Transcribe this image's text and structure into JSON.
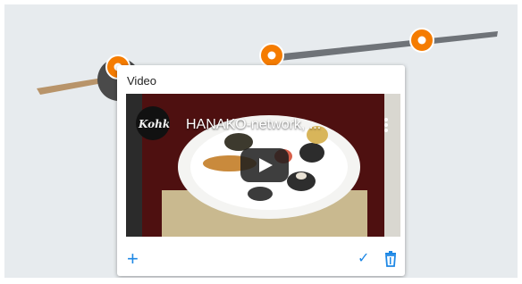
{
  "popup": {
    "title": "Video"
  },
  "video": {
    "channel_logo_text": "Kohk",
    "title": "HANAKO-network, ..."
  },
  "colors": {
    "accent": "#1e88e5",
    "marker": "#f57c00",
    "background": "#e7ebee"
  },
  "icons": {
    "add": "plus-icon",
    "confirm": "check-icon",
    "delete": "trash-icon",
    "play": "play-icon",
    "more": "more-vertical-icon"
  }
}
